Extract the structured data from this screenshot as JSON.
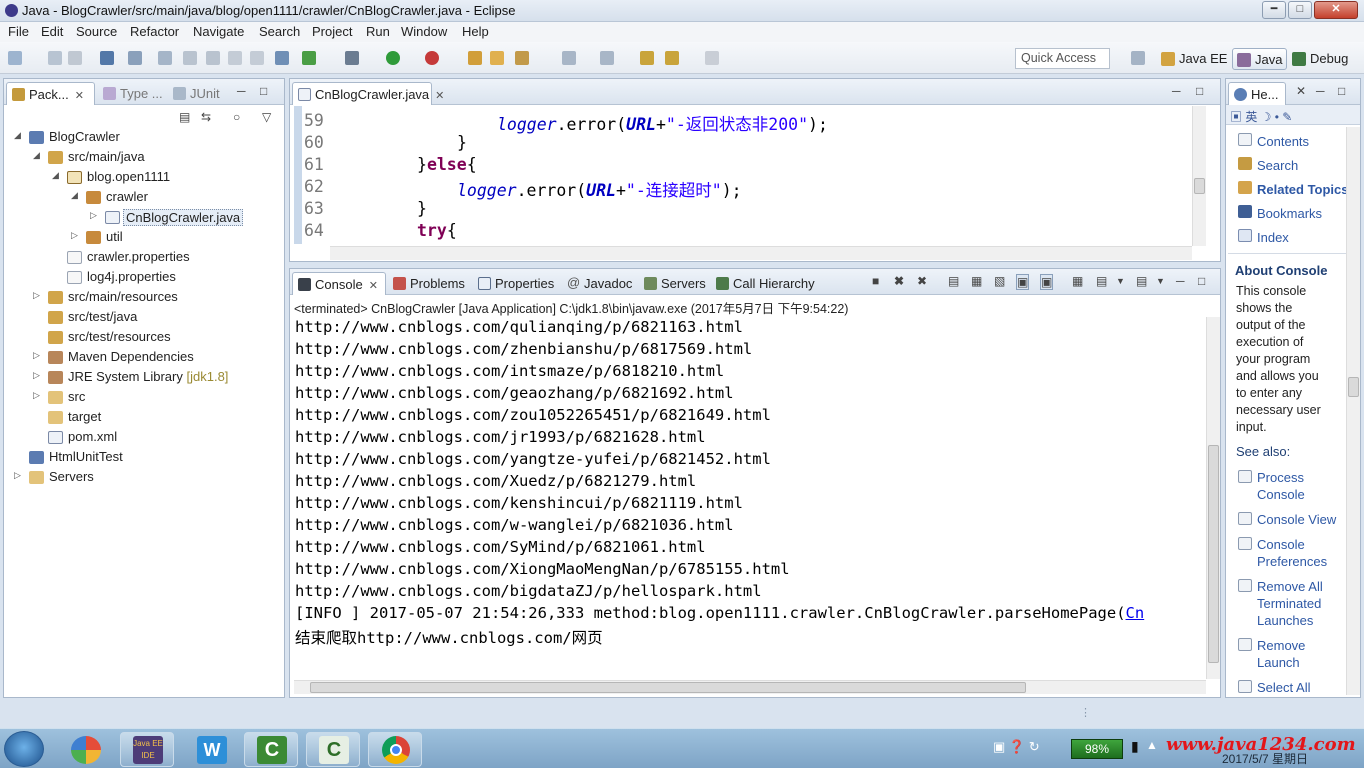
{
  "window": {
    "title": "Java - BlogCrawler/src/main/java/blog/open1111/crawler/CnBlogCrawler.java - Eclipse"
  },
  "menu": [
    "File",
    "Edit",
    "Source",
    "Refactor",
    "Navigate",
    "Search",
    "Project",
    "Run",
    "Window",
    "Help"
  ],
  "toolbar": {
    "quick_access": "Quick Access",
    "perspectives": [
      "Java EE",
      "Java",
      "Debug"
    ]
  },
  "package_explorer": {
    "tabs": [
      "Pack...",
      "Type ...",
      "JUnit"
    ],
    "tree": [
      {
        "label": "BlogCrawler",
        "decor": ""
      },
      {
        "label": "src/main/java",
        "decor": ""
      },
      {
        "label": "blog.open1111",
        "decor": ""
      },
      {
        "label": "crawler",
        "decor": ""
      },
      {
        "label": "CnBlogCrawler.java",
        "decor": ""
      },
      {
        "label": "util",
        "decor": ""
      },
      {
        "label": "crawler.properties",
        "decor": ""
      },
      {
        "label": "log4j.properties",
        "decor": ""
      },
      {
        "label": "src/main/resources",
        "decor": ""
      },
      {
        "label": "src/test/java",
        "decor": ""
      },
      {
        "label": "src/test/resources",
        "decor": ""
      },
      {
        "label": "Maven Dependencies",
        "decor": ""
      },
      {
        "label": "JRE System Library",
        "decor": "[jdk1.8]"
      },
      {
        "label": "src",
        "decor": ""
      },
      {
        "label": "target",
        "decor": ""
      },
      {
        "label": "pom.xml",
        "decor": ""
      },
      {
        "label": "HtmlUnitTest",
        "decor": ""
      },
      {
        "label": "Servers",
        "decor": ""
      }
    ]
  },
  "editor": {
    "tab": "CnBlogCrawler.java",
    "line_numbers": [
      "59",
      "60",
      "61",
      "62",
      "63",
      "64"
    ],
    "code": {
      "l59_obj": "logger",
      "l59_mid": ".error(",
      "l59_url": "URL",
      "l59_plus": "+",
      "l59_str": "\"-返回状态非200\"",
      "l59_end": ");",
      "l60": "}",
      "l61_brace": "}",
      "l61_else": "else",
      "l61_open": "{",
      "l62_obj": "logger",
      "l62_mid": ".error(",
      "l62_url": "URL",
      "l62_plus": "+",
      "l62_str": "\"-连接超时\"",
      "l62_end": ");",
      "l63": "}",
      "l64_try": "try",
      "l64_open": "{"
    }
  },
  "console": {
    "tabs": [
      "Console",
      "Problems",
      "Properties",
      "Javadoc",
      "Servers",
      "Call Hierarchy"
    ],
    "status": "<terminated> CnBlogCrawler [Java Application] C:\\jdk1.8\\bin\\javaw.exe (2017年5月7日 下午9:54:22)",
    "lines": [
      "http://www.cnblogs.com/qulianqing/p/6821163.html",
      "http://www.cnblogs.com/zhenbianshu/p/6817569.html",
      "http://www.cnblogs.com/intsmaze/p/6818210.html",
      "http://www.cnblogs.com/geaozhang/p/6821692.html",
      "http://www.cnblogs.com/zou1052265451/p/6821649.html",
      "http://www.cnblogs.com/jr1993/p/6821628.html",
      "http://www.cnblogs.com/yangtze-yufei/p/6821452.html",
      "http://www.cnblogs.com/Xuedz/p/6821279.html",
      "http://www.cnblogs.com/kenshincui/p/6821119.html",
      "http://www.cnblogs.com/w-wanglei/p/6821036.html",
      "http://www.cnblogs.com/SyMind/p/6821061.html",
      "http://www.cnblogs.com/XiongMaoMengNan/p/6785155.html",
      "http://www.cnblogs.com/bigdataZJ/p/hellospark.html"
    ],
    "info_line": "[INFO ] 2017-05-07 21:54:26,333 method:blog.open1111.crawler.CnBlogCrawler.parseHomePage(",
    "info_link": "Cn",
    "final_line": "结束爬取http://www.cnblogs.com/网页"
  },
  "help": {
    "tab": "He...",
    "links": [
      "Contents",
      "Search",
      "Related Topics",
      "Bookmarks",
      "Index"
    ],
    "about_title": "About Console",
    "about_text": "This console\nshows the\noutput of the\nexecution of\nyour program\nand allows you\nto enter any\nnecessary user\ninput.",
    "see_also": "See also:",
    "see_links": [
      "Process\nConsole",
      "Console View",
      "Console\nPreferences",
      "Remove All\nTerminated\nLaunches",
      "Remove\nLaunch",
      "Select All"
    ]
  },
  "taskbar": {
    "battery": "98%",
    "watermark": "www.java1234.com",
    "date": "2017/5/7 星期日"
  },
  "colors": {
    "keyword": "#7f0055",
    "field": "#0000c0",
    "string": "#2a00ff",
    "link": "#2e58a5"
  }
}
